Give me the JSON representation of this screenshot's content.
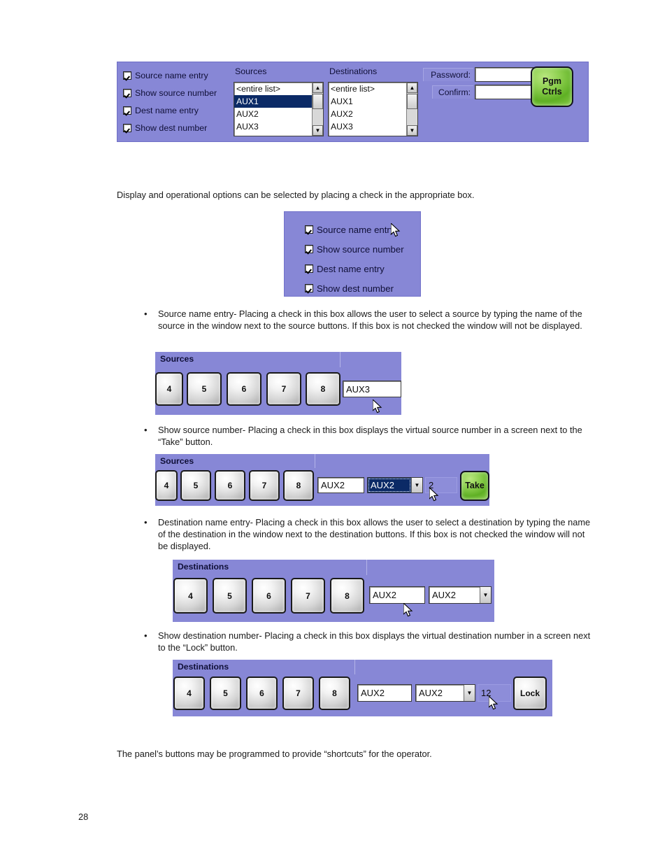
{
  "page": {
    "number": "28"
  },
  "paragraphs": {
    "intro": "Display and operational options can be selected by placing a check in the appropriate box.",
    "closing": "The panel’s buttons may be programmed to provide “shortcuts” for the operator."
  },
  "bullets": [
    {
      "id": "source-name-entry",
      "marker": "•",
      "text": "Source name entry- Placing a check in this box allows the user to select a source by typing the name of the source in the window next to the source buttons. If this box is not checked the window will not be displayed."
    },
    {
      "id": "show-source-number",
      "marker": "•",
      "text": "Show source number- Placing a check in this box displays the virtual source number in a screen next to the “Take” button."
    },
    {
      "id": "destination-name-entry",
      "marker": "•",
      "text": "Destination name entry- Placing a check in this box allows the user to select a destination by typing the name of the destination in the window next to the destination buttons. If this box is not checked the window will not be displayed."
    },
    {
      "id": "show-destination-number",
      "marker": "•",
      "text": "Show destination number- Placing a check in this box displays the virtual destination number in a screen next to the “Lock” button."
    }
  ],
  "top_panel": {
    "checkboxes": [
      {
        "label": "Source name entry",
        "checked": true
      },
      {
        "label": "Show source number",
        "checked": true
      },
      {
        "label": "Dest name entry",
        "checked": true
      },
      {
        "label": "Show dest number",
        "checked": true
      }
    ],
    "sources": {
      "header": "Sources",
      "items": [
        "<entire list>",
        "AUX1",
        "AUX2",
        "AUX3"
      ],
      "selected": "AUX1",
      "scroll_up_icon": "▲",
      "scroll_down_icon": "▼"
    },
    "destinations": {
      "header": "Destinations",
      "items": [
        "<entire list>",
        "AUX1",
        "AUX2",
        "AUX3"
      ],
      "selected": "",
      "scroll_up_icon": "▲",
      "scroll_down_icon": "▼"
    },
    "password": {
      "label": "Password:",
      "value": "",
      "placeholder": ""
    },
    "confirm": {
      "label": "Confirm:",
      "value": "",
      "placeholder": ""
    },
    "pgm_ctrls": {
      "line1": "Pgm",
      "line2": "Ctrls",
      "color": "#6fbf33"
    }
  },
  "checks_panel": {
    "checkboxes": [
      {
        "label": "Source name entry",
        "checked": true
      },
      {
        "label": "Show source number",
        "checked": true
      },
      {
        "label": "Dest name entry",
        "checked": true
      },
      {
        "label": "Show dest number",
        "checked": true
      }
    ]
  },
  "strip_source_name": {
    "header": "Sources",
    "buttons": [
      "4",
      "5",
      "6",
      "7",
      "8"
    ],
    "name_field": {
      "value": "AUX3",
      "placeholder": ""
    }
  },
  "strip_source_number": {
    "header": "Sources",
    "buttons": [
      "4",
      "5",
      "6",
      "7",
      "8"
    ],
    "name_field": {
      "value": "AUX2",
      "placeholder": ""
    },
    "combo": {
      "value": "AUX2",
      "arrow_icon": "▼"
    },
    "number_field": {
      "value": "2"
    },
    "take_button": {
      "label": "Take",
      "color": "#6fbf33"
    }
  },
  "strip_dest_name": {
    "header": "Destinations",
    "buttons": [
      "4",
      "5",
      "6",
      "7",
      "8"
    ],
    "name_field": {
      "value": "AUX2",
      "placeholder": ""
    },
    "combo": {
      "value": "AUX2",
      "arrow_icon": "▼"
    }
  },
  "strip_dest_number": {
    "header": "Destinations",
    "buttons": [
      "4",
      "5",
      "6",
      "7",
      "8"
    ],
    "name_field": {
      "value": "AUX2",
      "placeholder": ""
    },
    "combo": {
      "value": "AUX2",
      "arrow_icon": "▼"
    },
    "number_field": {
      "value": "12"
    },
    "lock_button": {
      "label": "Lock"
    }
  },
  "theme": {
    "panel_purple": "#8787d6",
    "list_selection": "#0b2a66",
    "green": "#6fbf33",
    "text_dark": "#101038"
  }
}
